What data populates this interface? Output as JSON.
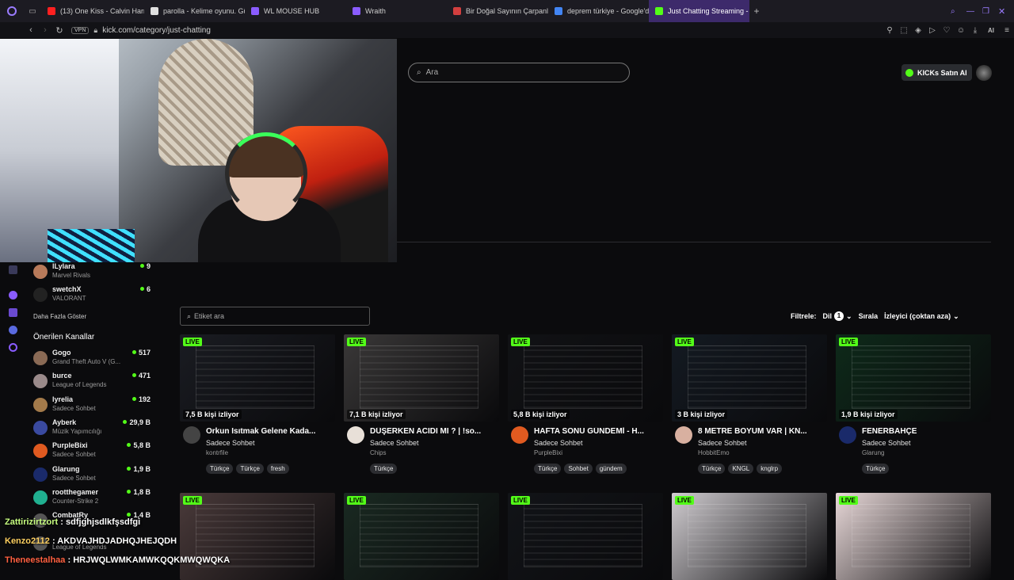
{
  "browser": {
    "tabs": [
      {
        "label": "(13) One Kiss - Calvin Harr",
        "color": "#ff2020"
      },
      {
        "label": "parolla - Kelime oyunu. Gü",
        "color": "#e0e0e0"
      },
      {
        "label": "WL MOUSE HUB",
        "color": "#8a5cff"
      },
      {
        "label": "Wraith",
        "color": "#8a5cff"
      },
      {
        "label": "Bir Doğal Sayının Çarpanl",
        "color": "#d23f3f"
      },
      {
        "label": "deprem türkiye - Google'd",
        "color": "#4285f4"
      },
      {
        "label": "Just Chatting Streaming -",
        "color": "#53fc18"
      }
    ],
    "new_tab": "+",
    "url": "kick.com/category/just-chatting",
    "vpn": "VPN",
    "ai_label": "AI"
  },
  "header": {
    "search_placeholder": "Ara",
    "buy_label": "KICKs Satın Al"
  },
  "sidebar": {
    "top_channels": [
      {
        "name": "lLylara",
        "game": "Marvel Rivals",
        "viewers": "9",
        "color": "#b87a5a"
      },
      {
        "name": "swetchX",
        "game": "VALORANT",
        "viewers": "6",
        "color": "#222"
      }
    ],
    "show_more": "Daha Fazla Göster",
    "recommended_title": "Önerilen Kanallar",
    "recommended": [
      {
        "name": "Gogo",
        "game": "Grand Theft Auto V (G...",
        "viewers": "517",
        "color": "#8a6a55"
      },
      {
        "name": "burce",
        "game": "League of Legends",
        "viewers": "471",
        "color": "#9a8a8a"
      },
      {
        "name": "lyrelia",
        "game": "Sadece Sohbet",
        "viewers": "192",
        "color": "#a37a4a"
      },
      {
        "name": "Ayberk",
        "game": "Müzik Yapımcılığı",
        "viewers": "29,9 B",
        "color": "#3a4aa0"
      },
      {
        "name": "PurpleBixi",
        "game": "Sadece Sohbet",
        "viewers": "5,8 B",
        "color": "#e05a20"
      },
      {
        "name": "Glarung",
        "game": "Sadece Sohbet",
        "viewers": "1,9 B",
        "color": "#1a2a6a"
      },
      {
        "name": "rootthegamer",
        "game": "Counter-Strike 2",
        "viewers": "1,8 B",
        "color": "#20b090"
      },
      {
        "name": "CombatRy",
        "game": "",
        "viewers": "1,4 B",
        "color": "#555"
      },
      {
        "name": "",
        "game": "League of Legends",
        "viewers": "",
        "color": "#555"
      }
    ]
  },
  "filters": {
    "tag_placeholder": "Etiket ara",
    "filter_label": "Filtrele:",
    "language_label": "Dil",
    "language_count": "1",
    "sort_label": "Sırala",
    "sort_value": "İzleyici (çoktan aza)"
  },
  "live_badge": "LIVE",
  "streams": [
    {
      "viewers": "7,5 B kişi izliyor",
      "title": "Orkun Isıtmak Gelene Kada...",
      "category": "Sadece Sohbet",
      "channel": "kontrfile",
      "tags": [
        "Türkçe",
        "Türkçe",
        "fresh"
      ],
      "thumb": "#1a1c22",
      "avatar": "#444"
    },
    {
      "viewers": "7,1 B kişi izliyor",
      "title": "DÜŞERKEN ACIDI MI ? | !so...",
      "category": "Sadece Sohbet",
      "channel": "Chips",
      "tags": [
        "Türkçe"
      ],
      "thumb": "#3a3838",
      "avatar": "#e8e0d8"
    },
    {
      "viewers": "5,8 B kişi izliyor",
      "title": "HAFTA SONU GÜNDEMİ - H...",
      "category": "Sadece Sohbet",
      "channel": "PurpleBixi",
      "tags": [
        "Türkçe",
        "Sohbet",
        "gündem"
      ],
      "thumb": "#111215",
      "avatar": "#e05a20"
    },
    {
      "viewers": "3 B kişi izliyor",
      "title": "8 METRE BOYUM VAR | KN...",
      "category": "Sadece Sohbet",
      "channel": "HobbitEmo",
      "tags": [
        "Türkçe",
        "KNGL",
        "knglrp"
      ],
      "thumb": "#141a22",
      "avatar": "#d8b0a0"
    },
    {
      "viewers": "1,9 B kişi izliyor",
      "title": "FENERBAHÇE",
      "category": "Sadece Sohbet",
      "channel": "Glarung",
      "tags": [
        "Türkçe"
      ],
      "thumb": "#0e2a1a",
      "avatar": "#1a2a6a"
    },
    {
      "thumb": "#4a3a3a"
    },
    {
      "thumb": "#1a2a22"
    },
    {
      "thumb": "#121418"
    },
    {
      "thumb": "#d0ccd0"
    },
    {
      "thumb": "#e8d8d8"
    }
  ],
  "chat": [
    {
      "user": "Zattirizirtzort",
      "msg": ": sdfjghjsdlkfşsdfgi",
      "color": "#c8ff80"
    },
    {
      "user": "Kenzo2112",
      "msg": ": AKDVAJHDJADHQJHEJQDH",
      "color": "#ffd060"
    },
    {
      "user": "Theneestalhaa",
      "msg": ": HRJWQLWMKAMWKQQKMWQWQKA",
      "color": "#ff6040"
    }
  ]
}
